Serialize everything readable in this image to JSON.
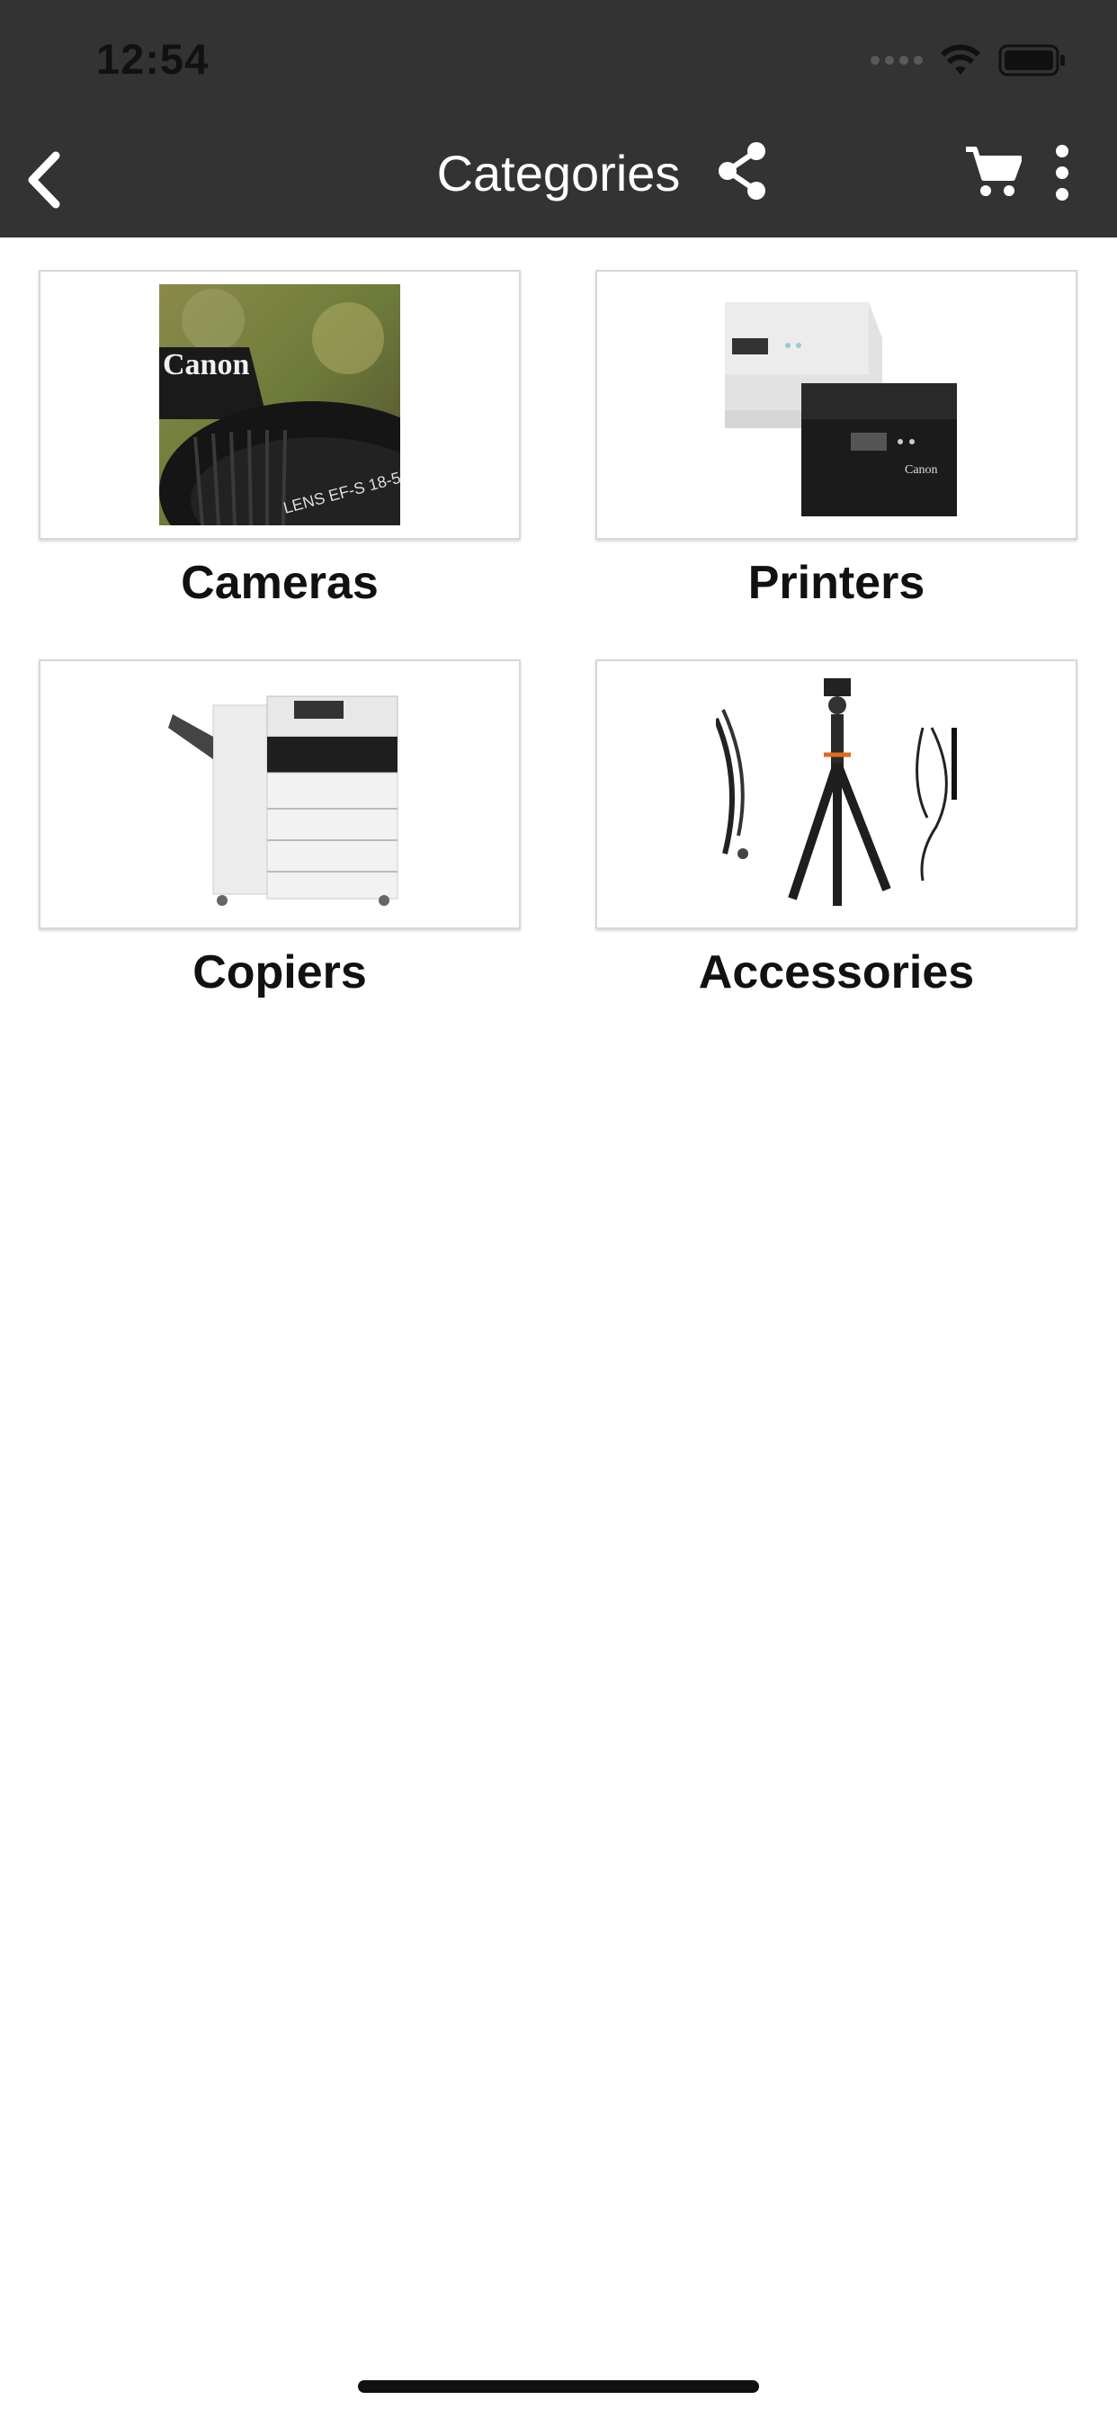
{
  "status_bar": {
    "time": "12:54"
  },
  "nav": {
    "title": "Categories"
  },
  "categories": [
    {
      "label": "Cameras",
      "image": "camera-lens-photo"
    },
    {
      "label": "Printers",
      "image": "printer-photo"
    },
    {
      "label": "Copiers",
      "image": "copier-photo"
    },
    {
      "label": "Accessories",
      "image": "tripod-cables-photo"
    }
  ],
  "icons": {
    "back": "chevron-left-icon",
    "share": "share-icon",
    "cart": "cart-icon",
    "more": "more-vertical-icon",
    "wifi": "wifi-icon",
    "battery": "battery-icon"
  },
  "colors": {
    "topbar": "#333333",
    "background": "#ffffff"
  }
}
